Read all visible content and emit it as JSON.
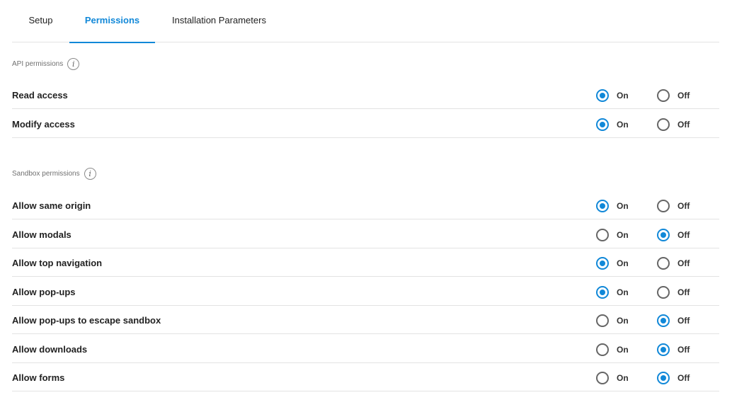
{
  "tabs": [
    {
      "label": "Setup",
      "active": false
    },
    {
      "label": "Permissions",
      "active": true
    },
    {
      "label": "Installation Parameters",
      "active": false
    }
  ],
  "sections": {
    "api": {
      "title": "API permissions",
      "info_icon": "info-icon",
      "rows": [
        {
          "label": "Read access",
          "value": "On"
        },
        {
          "label": "Modify access",
          "value": "On"
        }
      ]
    },
    "sandbox": {
      "title": "Sandbox permissions",
      "info_icon": "info-icon",
      "rows": [
        {
          "label": "Allow same origin",
          "value": "On"
        },
        {
          "label": "Allow modals",
          "value": "Off"
        },
        {
          "label": "Allow top navigation",
          "value": "On"
        },
        {
          "label": "Allow pop-ups",
          "value": "On"
        },
        {
          "label": "Allow pop-ups to escape sandbox",
          "value": "Off"
        },
        {
          "label": "Allow downloads",
          "value": "Off"
        },
        {
          "label": "Allow forms",
          "value": "Off"
        }
      ]
    }
  },
  "options": {
    "on_label": "On",
    "off_label": "Off"
  },
  "colors": {
    "accent": "#1188d8",
    "radio_border": "#666666",
    "divider": "#e3e3e3"
  }
}
